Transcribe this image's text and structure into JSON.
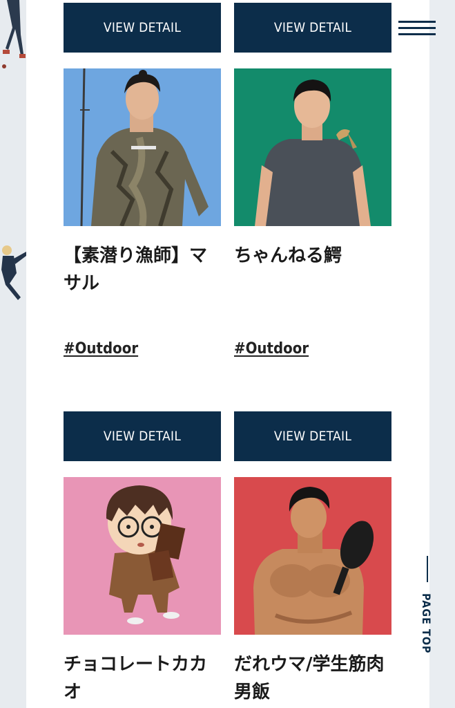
{
  "menu": {
    "icon": "hamburger-menu-icon"
  },
  "page_top": {
    "label": "PAGE TOP"
  },
  "colors": {
    "navy": "#0c2d4a",
    "panel": "#ffffff",
    "side": "#e9edf1"
  },
  "cards": [
    {
      "button": "VIEW DETAIL",
      "name": "【素潜り漁師】マサル",
      "tag": "#Outdoor",
      "thumb_bg": "#6ea6e0"
    },
    {
      "button": "VIEW DETAIL",
      "name": "ちゃんねる鰐",
      "tag": "#Outdoor",
      "thumb_bg": "#138b6b"
    },
    {
      "button": "VIEW DETAIL",
      "name": "チョコレートカカオ",
      "tag": "",
      "thumb_bg": "#e895b6"
    },
    {
      "button": "VIEW DETAIL",
      "name": "だれウマ/学生筋肉男飯",
      "tag": "",
      "thumb_bg": "#d84a4d"
    }
  ]
}
